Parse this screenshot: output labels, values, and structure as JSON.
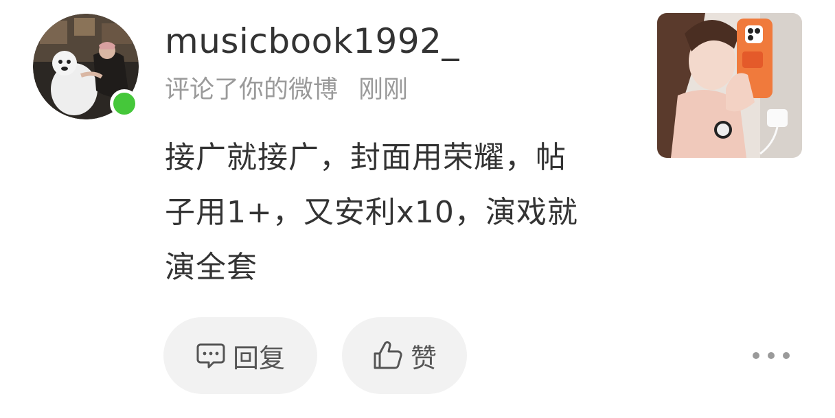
{
  "user": {
    "name": "musicbook1992_",
    "online": true
  },
  "notification": {
    "action_text": "评论了你的微博",
    "time": "刚刚"
  },
  "comment": {
    "text": "接广就接广，封面用荣耀，帖子用1+，又安利x10，演戏就演全套"
  },
  "buttons": {
    "reply_label": "回复",
    "like_label": "赞"
  },
  "icons": {
    "reply": "comment-bubble-icon",
    "like": "thumbs-up-icon",
    "more": "more-dots-icon"
  },
  "colors": {
    "online_dot": "#45c73a",
    "text_primary": "#333333",
    "text_secondary": "#9a9a9a",
    "pill_bg": "#f2f2f2"
  }
}
